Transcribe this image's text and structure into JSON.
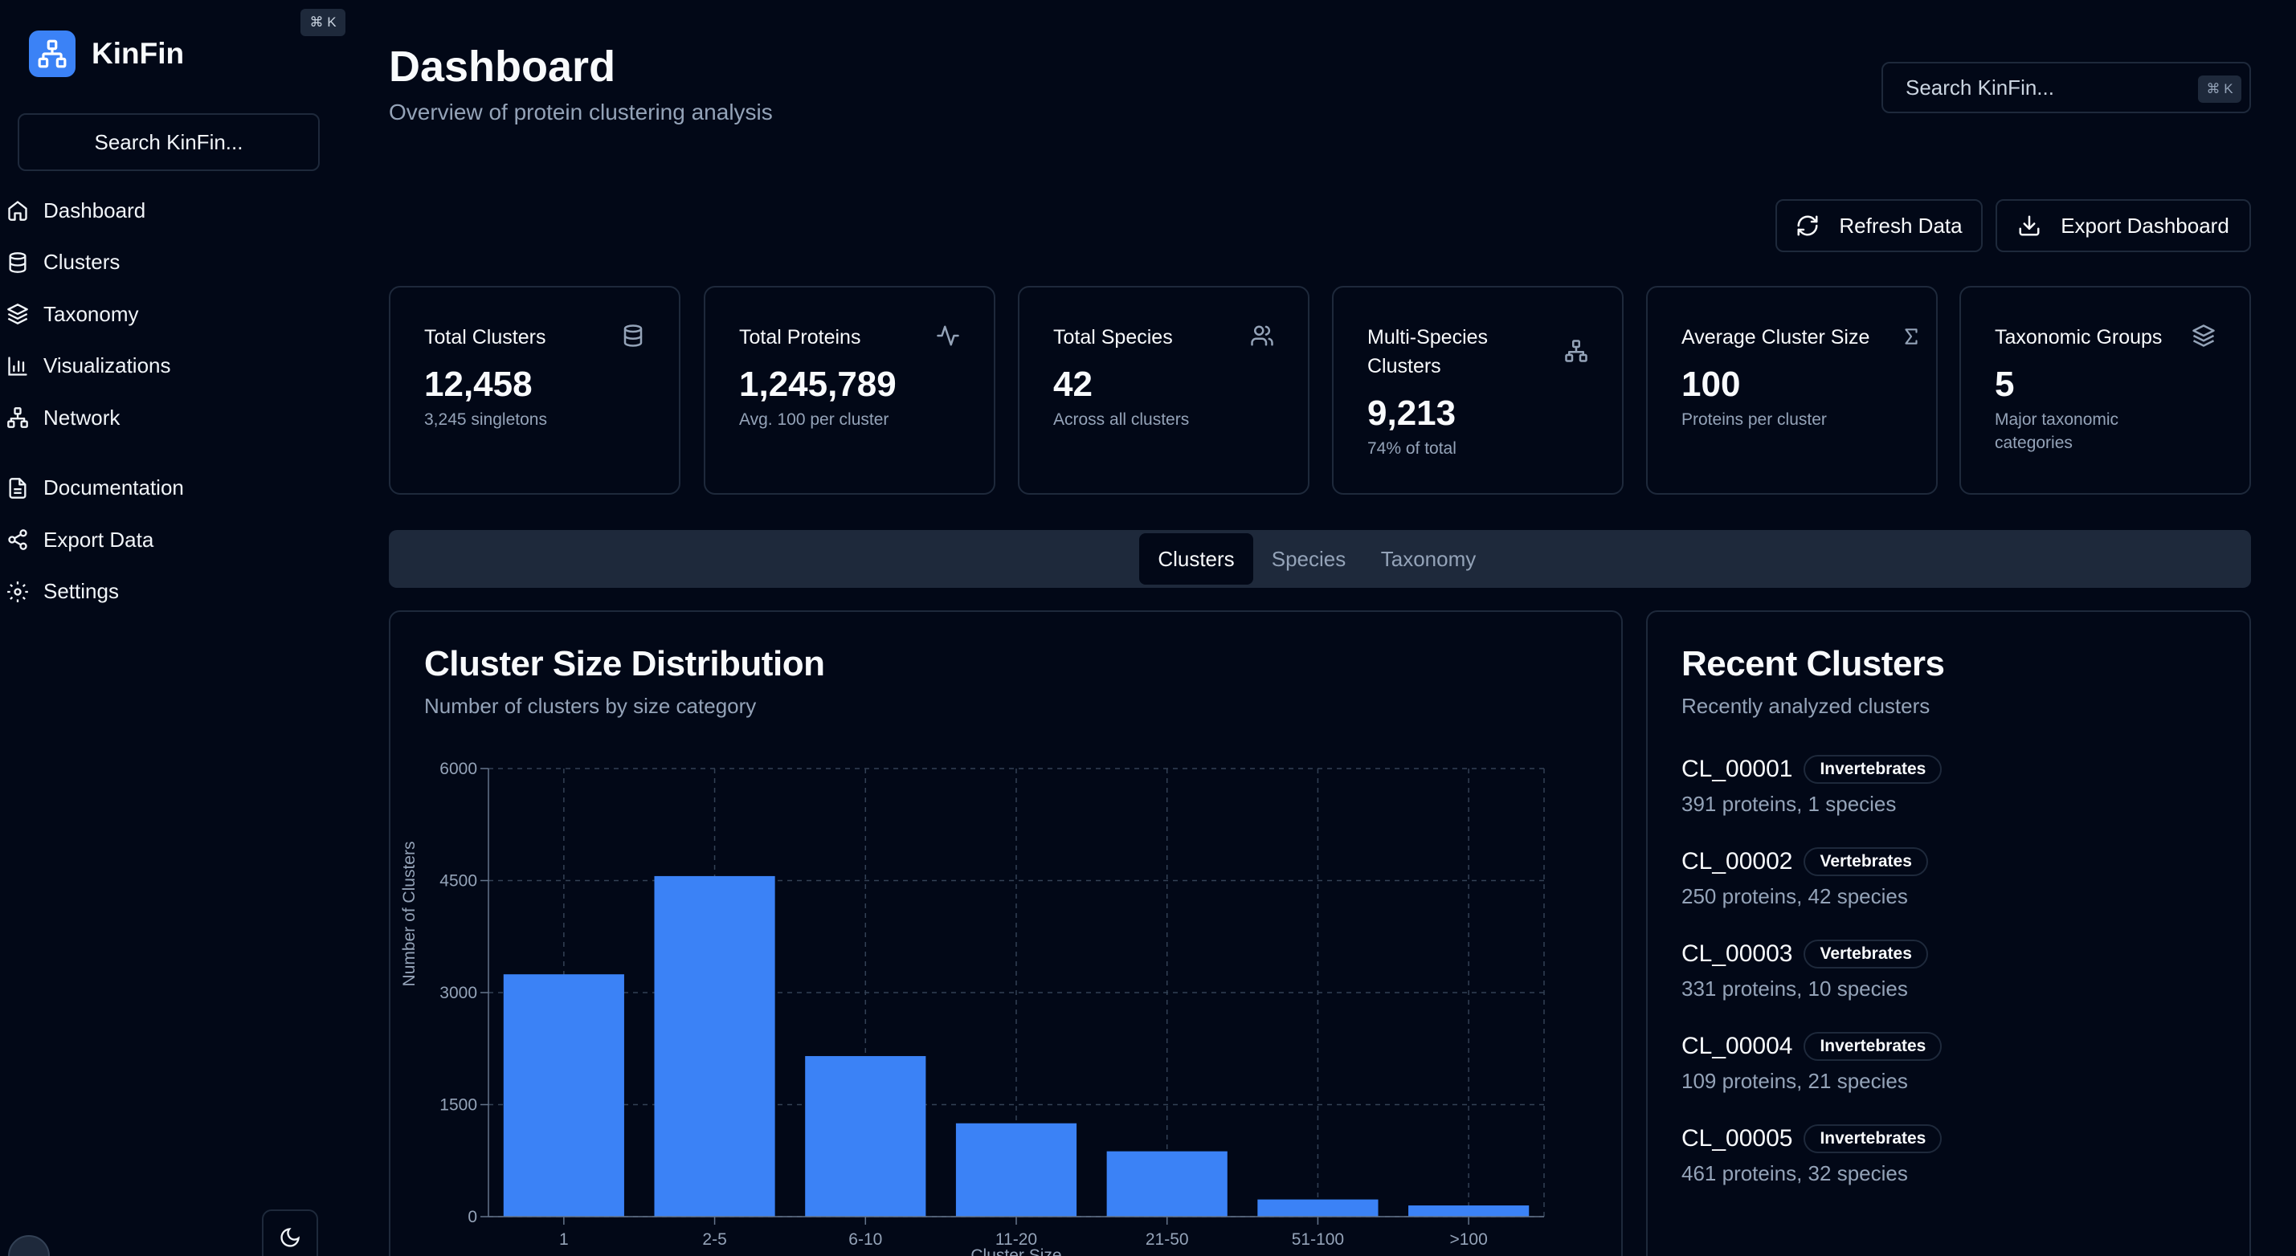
{
  "app": {
    "name": "KinFin",
    "shortcut": "⌘ K"
  },
  "sidebar": {
    "search_label": "Search KinFin...",
    "items": [
      {
        "label": "Dashboard",
        "icon": "home-icon"
      },
      {
        "label": "Clusters",
        "icon": "database-icon"
      },
      {
        "label": "Taxonomy",
        "icon": "layers-icon"
      },
      {
        "label": "Visualizations",
        "icon": "bar-chart-icon"
      },
      {
        "label": "Network",
        "icon": "network-icon"
      }
    ],
    "secondary_items": [
      {
        "label": "Documentation",
        "icon": "file-icon"
      },
      {
        "label": "Export Data",
        "icon": "share-icon"
      },
      {
        "label": "Settings",
        "icon": "gear-icon"
      }
    ]
  },
  "header": {
    "title": "Dashboard",
    "subtitle": "Overview of protein clustering analysis",
    "search_placeholder": "Search KinFin...",
    "search_kbd": "⌘ K",
    "refresh_label": "Refresh Data",
    "export_label": "Export Dashboard"
  },
  "stats": [
    {
      "title": "Total Clusters",
      "value": "12,458",
      "sub": "3,245 singletons",
      "icon": "database-icon"
    },
    {
      "title": "Total Proteins",
      "value": "1,245,789",
      "sub": "Avg. 100 per cluster",
      "icon": "activity-icon"
    },
    {
      "title": "Total Species",
      "value": "42",
      "sub": "Across all clusters",
      "icon": "users-icon"
    },
    {
      "title": "Multi-Species Clusters",
      "value": "9,213",
      "sub": "74% of total",
      "icon": "network-icon"
    },
    {
      "title": "Average Cluster Size",
      "value": "100",
      "sub": "Proteins per cluster",
      "icon": "sigma-icon"
    },
    {
      "title": "Taxonomic Groups",
      "value": "5",
      "sub": "Major taxonomic categories",
      "icon": "layers-icon"
    }
  ],
  "tabs": [
    {
      "label": "Clusters",
      "active": true
    },
    {
      "label": "Species",
      "active": false
    },
    {
      "label": "Taxonomy",
      "active": false
    }
  ],
  "distribution": {
    "title": "Cluster Size Distribution",
    "subtitle": "Number of clusters by size category"
  },
  "chart_data": {
    "type": "bar",
    "categories": [
      "1",
      "2-5",
      "6-10",
      "11-20",
      "21-50",
      "51-100",
      ">100"
    ],
    "values": [
      3245,
      4560,
      2150,
      1250,
      875,
      230,
      150
    ],
    "ylabel": "Number of Clusters",
    "xlabel": "Cluster Size",
    "ylim": [
      0,
      6000
    ],
    "yticks": [
      0,
      1500,
      3000,
      4500,
      6000
    ],
    "grid": true,
    "bar_color": "#3b82f6"
  },
  "recent": {
    "title": "Recent Clusters",
    "subtitle": "Recently analyzed clusters",
    "items": [
      {
        "id": "CL_00001",
        "group": "Invertebrates",
        "meta": "391 proteins, 1 species"
      },
      {
        "id": "CL_00002",
        "group": "Vertebrates",
        "meta": "250 proteins, 42 species"
      },
      {
        "id": "CL_00003",
        "group": "Vertebrates",
        "meta": "331 proteins, 10 species"
      },
      {
        "id": "CL_00004",
        "group": "Invertebrates",
        "meta": "109 proteins, 21 species"
      },
      {
        "id": "CL_00005",
        "group": "Invertebrates",
        "meta": "461 proteins, 32 species"
      }
    ]
  },
  "colors": {
    "background": "#020817",
    "border": "#1e293b",
    "accent": "#3b82f6",
    "muted": "#94a3b8"
  }
}
